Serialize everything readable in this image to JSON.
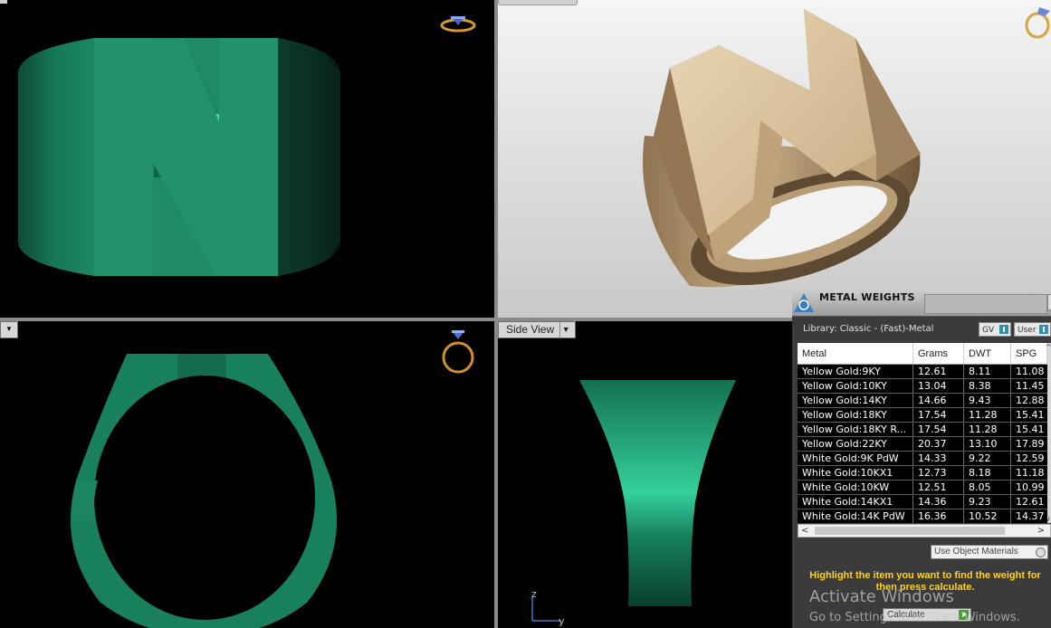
{
  "viewports": {
    "side": {
      "label": "Side View"
    },
    "axes": {
      "z": "z",
      "y": "y"
    }
  },
  "panel": {
    "title": "METAL WEIGHTS",
    "library": "Library: Classic - (Fast)-Metal",
    "gv_button": "GV",
    "user_button": "User",
    "columns": [
      "Metal",
      "Grams",
      "DWT",
      "SPG"
    ],
    "rows": [
      [
        "Yellow Gold:9KY",
        "12.61",
        "8.11",
        "11.08"
      ],
      [
        "Yellow Gold:10KY",
        "13.04",
        "8.38",
        "11.45"
      ],
      [
        "Yellow Gold:14KY",
        "14.66",
        "9.43",
        "12.88"
      ],
      [
        "Yellow Gold:18KY",
        "17.54",
        "11.28",
        "15.41"
      ],
      [
        "Yellow Gold:18KY R...",
        "17.54",
        "11.28",
        "15.41"
      ],
      [
        "Yellow Gold:22KY",
        "20.37",
        "13.10",
        "17.89"
      ],
      [
        "White Gold:9K PdW",
        "14.33",
        "9.22",
        "12.59"
      ],
      [
        "White Gold:10KX1",
        "12.73",
        "8.18",
        "11.18"
      ],
      [
        "White Gold:10KW",
        "12.51",
        "8.05",
        "10.99"
      ],
      [
        "White Gold:14KX1",
        "14.36",
        "9.23",
        "12.61"
      ],
      [
        "White Gold:14K PdW",
        "16.36",
        "10.52",
        "14.37"
      ]
    ],
    "use_object_materials": "Use Object Materials",
    "hint": "Highlight the item you want to find the weight for then press calculate.",
    "calculate": "Calculate"
  },
  "watermark": {
    "line1": "Activate Windows",
    "line2": "Go to Settings to activate Windows."
  },
  "colors": {
    "jade": "#1f8f68",
    "gold": "#d9c29f",
    "hint": "#ffd21c"
  }
}
